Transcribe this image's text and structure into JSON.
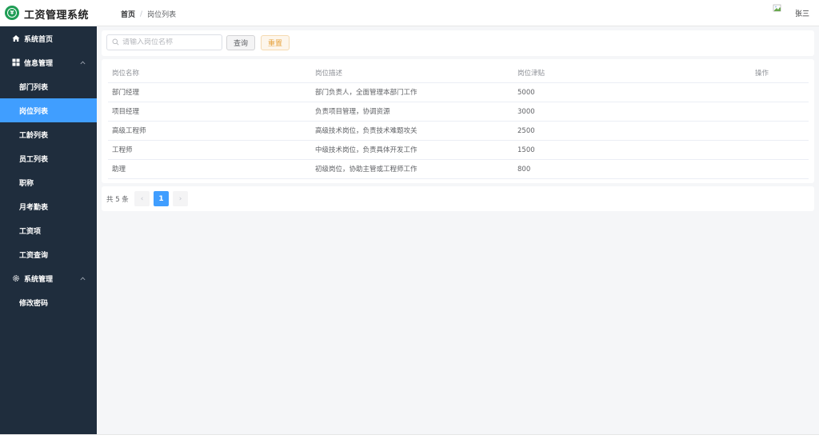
{
  "header": {
    "app_title": "工资管理系统",
    "breadcrumb": {
      "home": "首页",
      "separator": "/",
      "current": "岗位列表"
    },
    "user": {
      "name": "张三"
    }
  },
  "sidebar": {
    "items": [
      {
        "label": "系统首页",
        "icon": "home-icon"
      },
      {
        "label": "信息管理",
        "icon": "grid-icon",
        "expanded": true
      },
      {
        "label": "部门列表"
      },
      {
        "label": "岗位列表",
        "active": true
      },
      {
        "label": "工龄列表"
      },
      {
        "label": "员工列表"
      },
      {
        "label": "职称"
      },
      {
        "label": "月考勤表"
      },
      {
        "label": "工资项"
      },
      {
        "label": "工资查询"
      },
      {
        "label": "系统管理",
        "icon": "gear-icon",
        "expanded": true
      },
      {
        "label": "修改密码"
      }
    ]
  },
  "search": {
    "placeholder": "请输入岗位名称",
    "query_label": "查询",
    "reset_label": "重置"
  },
  "table": {
    "columns": [
      "岗位名称",
      "岗位描述",
      "岗位津贴",
      "操作"
    ],
    "rows": [
      {
        "name": "部门经理",
        "desc": "部门负责人，全面管理本部门工作",
        "allowance": "5000"
      },
      {
        "name": "项目经理",
        "desc": "负责项目管理，协调资源",
        "allowance": "3000"
      },
      {
        "name": "高级工程师",
        "desc": "高级技术岗位，负责技术难题攻关",
        "allowance": "2500"
      },
      {
        "name": "工程师",
        "desc": "中级技术岗位，负责具体开发工作",
        "allowance": "1500"
      },
      {
        "name": "助理",
        "desc": "初级岗位，协助主管或工程师工作",
        "allowance": "800"
      }
    ]
  },
  "pagination": {
    "total_text": "共 5 条",
    "prev": "‹",
    "current_page": "1",
    "next": "›"
  },
  "colors": {
    "sidebar_bg": "#1f2d3d",
    "active": "#409eff",
    "logo": "#1f9d55",
    "reset": "#e6a23c"
  }
}
